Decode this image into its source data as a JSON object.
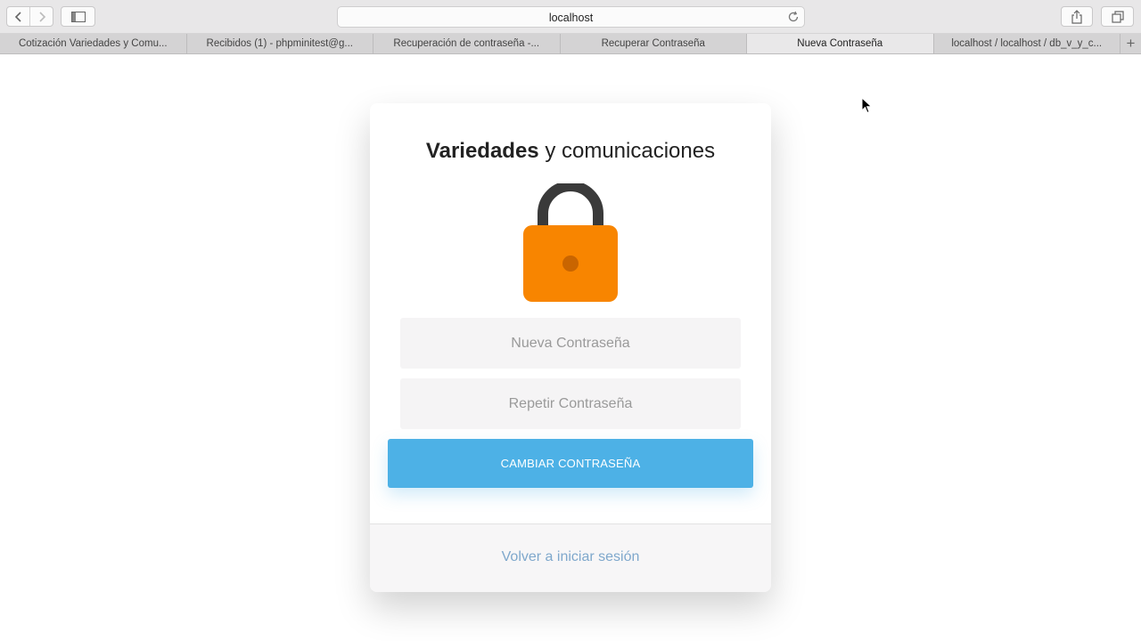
{
  "browser": {
    "url": "localhost",
    "tabs": [
      {
        "label": "Cotización Variedades y Comu...",
        "active": false
      },
      {
        "label": "Recibidos (1) - phpminitest@g...",
        "active": false
      },
      {
        "label": "Recuperación de contraseña -...",
        "active": false
      },
      {
        "label": "Recuperar Contraseña",
        "active": false
      },
      {
        "label": "Nueva Contraseña",
        "active": true
      },
      {
        "label": "localhost / localhost / db_v_y_c...",
        "active": false
      }
    ],
    "icons": [
      "back-icon",
      "forward-icon",
      "sidebar-icon",
      "reload-icon",
      "share-icon",
      "tabs-overview-icon",
      "new-tab-icon"
    ]
  },
  "card": {
    "title_bold": "Variedades",
    "title_rest": " y comunicaciones",
    "icon": "lock-icon",
    "new_password_placeholder": "Nueva Contraseña",
    "repeat_password_placeholder": "Repetir Contraseña",
    "submit_label": "CAMBIAR CONTRASEÑA",
    "back_link": "Volver a iniciar sesión"
  },
  "colors": {
    "accent": "#4db1e6",
    "lock_body": "#f88500",
    "lock_shackle": "#3a3a3a",
    "link": "#7fa8cc"
  }
}
